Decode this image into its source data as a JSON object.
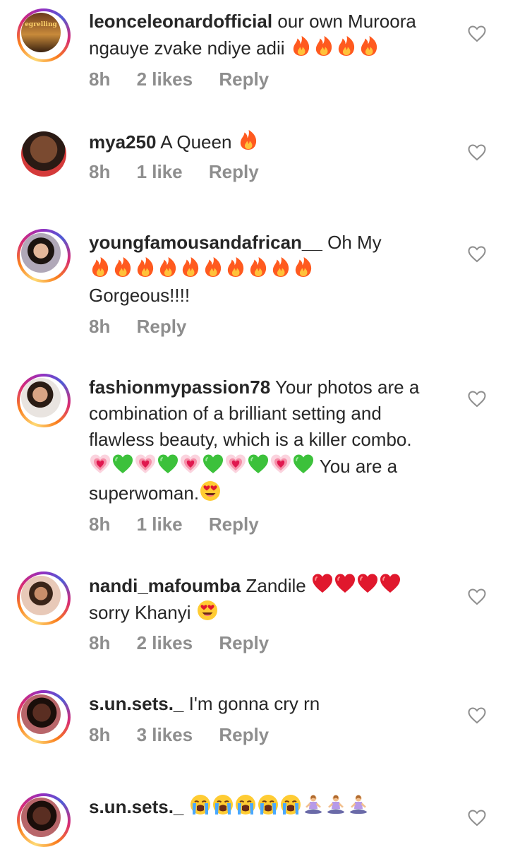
{
  "comments": [
    {
      "username": "leonceleonardofficial",
      "text": "our own Muroora ngauye zvake ndiye adii",
      "emoji": "🔥🔥🔥🔥",
      "time": "8h",
      "likes": "2 likes",
      "reply": "Reply",
      "avatar_text": "egrelling"
    },
    {
      "username": "mya250",
      "text": "A Queen",
      "emoji": "🔥",
      "time": "8h",
      "likes": "1 like",
      "reply": "Reply"
    },
    {
      "username": "youngfamousandafrican__",
      "text": "Oh My",
      "emoji": "🔥🔥🔥🔥🔥🔥🔥🔥🔥🔥",
      "text2": "Gorgeous!!!!",
      "time": "8h",
      "reply": "Reply"
    },
    {
      "username": "fashionmypassion78",
      "text": "Your photos are a combination of a brilliant setting and flawless beauty, which is a killer combo.",
      "emoji": "💗💚💗💚💗💚💗💚💗💚",
      "text2": "You are a superwoman.",
      "emoji2": "😍",
      "time": "8h",
      "likes": "1 like",
      "reply": "Reply"
    },
    {
      "username": "nandi_mafoumba",
      "text": "Zandile",
      "emoji": "❤️❤️❤️❤️",
      "text2": "sorry Khanyi",
      "emoji2": "😍",
      "time": "8h",
      "likes": "2 likes",
      "reply": "Reply"
    },
    {
      "username": "s.un.sets._",
      "text": "I'm gonna cry rn",
      "time": "8h",
      "likes": "3 likes",
      "reply": "Reply"
    },
    {
      "username": "s.un.sets._",
      "emoji": "😭😭😭😭😭🧘‍♀️🧘‍♀️🧘‍♀️"
    }
  ],
  "colors": {
    "text": "#262626",
    "meta": "#8e8e8e",
    "fire": "#ff5a1f",
    "heart_red": "#e0182d",
    "green_heart": "#3cc13b",
    "pink_heart": "#f58fa8"
  }
}
